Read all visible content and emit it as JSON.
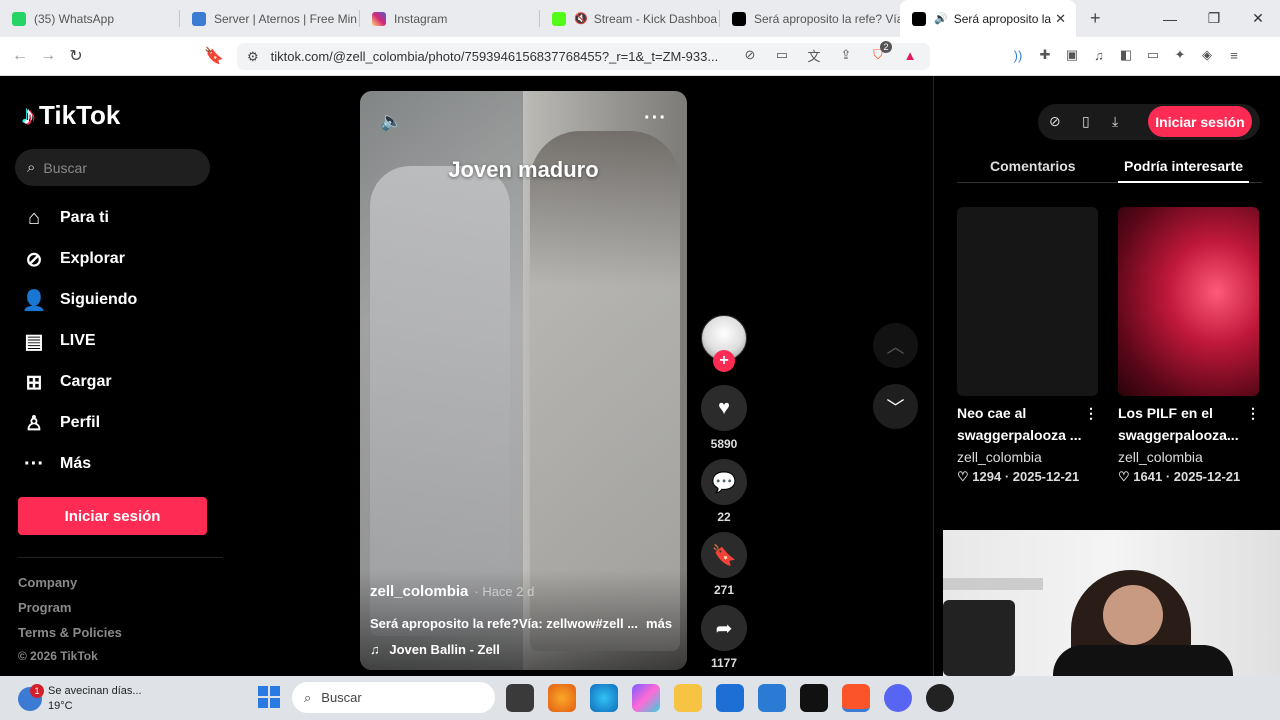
{
  "browser": {
    "tabs": [
      {
        "label": "(35) WhatsApp",
        "favicon_color": "#25d366"
      },
      {
        "label": "Server | Aternos | Free Min",
        "favicon_color": "#3b7bd4"
      },
      {
        "label": "Instagram",
        "favicon_color": "#d62976"
      },
      {
        "label": "Stream - Kick Dashboa",
        "favicon_color": "#53fc18"
      },
      {
        "label": "Será aproposito la refe? Vía",
        "favicon_color": "#000000"
      },
      {
        "label": "Será aproposito la",
        "favicon_color": "#000000",
        "active": true
      }
    ],
    "url": "tiktok.com/@zell_colombia/photo/7593946156837768455?_r=1&_t=ZM-933...",
    "shield_badge": "2"
  },
  "sidebar": {
    "logo": "TikTok",
    "search_placeholder": "Buscar",
    "nav": [
      {
        "label": "Para ti",
        "icon": "home-icon"
      },
      {
        "label": "Explorar",
        "icon": "compass-icon"
      },
      {
        "label": "Siguiendo",
        "icon": "following-icon"
      },
      {
        "label": "LIVE",
        "icon": "live-icon"
      },
      {
        "label": "Cargar",
        "icon": "upload-icon"
      },
      {
        "label": "Perfil",
        "icon": "profile-icon"
      },
      {
        "label": "Más",
        "icon": "more-icon"
      }
    ],
    "login": "Iniciar sesión",
    "footer": [
      "Company",
      "Program",
      "Terms & Policies"
    ],
    "copyright": "© 2026 TikTok"
  },
  "post": {
    "overlay_text": "Joven maduro",
    "username": "zell_colombia",
    "ago": "· Hace 2 d",
    "description": "Será aproposito la refe?Vía: zellwow#zell ...",
    "more": "más",
    "music": "Joven Ballin - Zell",
    "likes": "5890",
    "comments": "22",
    "saves": "271",
    "shares": "1177"
  },
  "right": {
    "login": "Iniciar sesión",
    "tabs": [
      "Comentarios",
      "Podría interesarte"
    ],
    "cards": [
      {
        "title": "Neo cae al swaggerpalooza ...",
        "author": "zell_colombia",
        "likes": "1294",
        "date": "2025-12-21"
      },
      {
        "title": "Los PILF en el swaggerpalooza...",
        "author": "zell_colombia",
        "likes": "1641",
        "date": "2025-12-21"
      }
    ]
  },
  "taskbar": {
    "weather_text": "Se avecinan días...",
    "temp": "19°C",
    "badge": "1",
    "search": "Buscar"
  }
}
